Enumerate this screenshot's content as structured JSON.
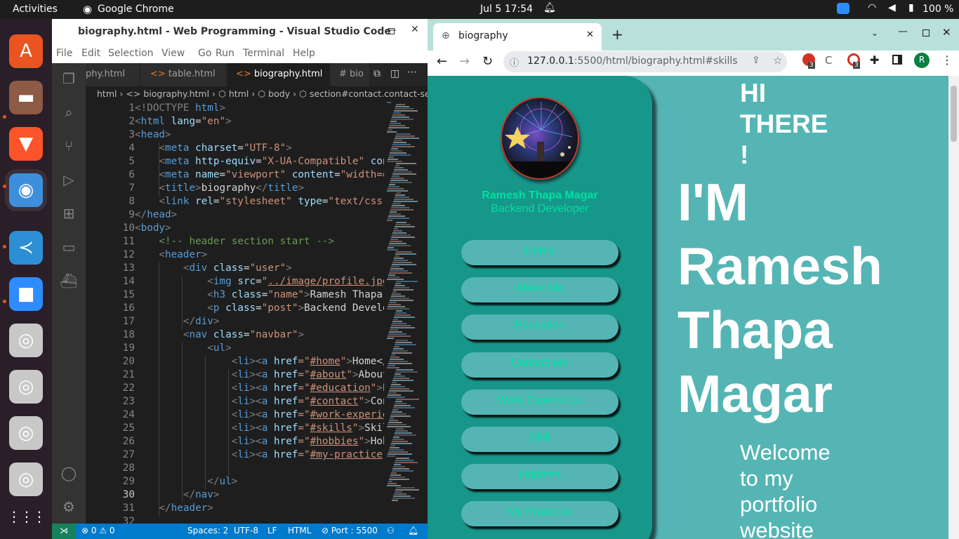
{
  "topbar": {
    "activities": "Activities",
    "app": "Google Chrome",
    "clock": "Jul 5  17:54",
    "battery": "100 %"
  },
  "dock": {
    "items": [
      {
        "name": "software-icon",
        "glyph": "A",
        "color": "#e95420"
      },
      {
        "name": "files-icon",
        "glyph": "▬",
        "color": "#8d5a46"
      },
      {
        "name": "brave-icon",
        "glyph": "▼",
        "color": "#fb542b"
      },
      {
        "name": "chrome-icon",
        "glyph": "◉",
        "color": "#3d8fdc"
      },
      {
        "name": "vscode-icon",
        "glyph": "≺",
        "color": "#2c8fd6"
      },
      {
        "name": "zoom-icon",
        "glyph": "■",
        "color": "#2d8cff"
      },
      {
        "name": "disc-icon-1",
        "glyph": "◎",
        "color": "#c8c8c8"
      },
      {
        "name": "disc-icon-2",
        "glyph": "◎",
        "color": "#c8c8c8"
      },
      {
        "name": "disc-icon-3",
        "glyph": "◎",
        "color": "#c8c8c8"
      },
      {
        "name": "disc-icon-4",
        "glyph": "◎",
        "color": "#c8c8c8"
      }
    ],
    "apps_grid": "⋮⋮⋮"
  },
  "vscode": {
    "title": "biography.html - Web Programming - Visual Studio Code",
    "menu": [
      "File",
      "Edit",
      "Selection",
      "View",
      "Go",
      "Run",
      "Terminal",
      "Help"
    ],
    "tabs": [
      "phy.html",
      "table.html",
      "biography.html",
      "# bio"
    ],
    "breadcrumb": "html  ›  <> biography.html  ›  ⬡ html  ›  ⬡ body  ›  ⬡ section#contact.contact-se",
    "lines": [
      [
        {
          "t": "<!DOCTYPE ",
          "c": "#808080"
        },
        {
          "t": "html",
          "c": "#569cd6"
        },
        {
          "t": ">",
          "c": "#808080"
        }
      ],
      [
        {
          "t": "<",
          "c": "#808080"
        },
        {
          "t": "html ",
          "c": "#569cd6"
        },
        {
          "t": "lang",
          "c": "#9cdcfe"
        },
        {
          "t": "=",
          "c": "#d4d4d4"
        },
        {
          "t": "\"en\"",
          "c": "#ce9178"
        },
        {
          "t": ">",
          "c": "#808080"
        }
      ],
      [
        {
          "t": "<",
          "c": "#808080"
        },
        {
          "t": "head",
          "c": "#569cd6"
        },
        {
          "t": ">",
          "c": "#808080"
        }
      ],
      [
        {
          "t": "    <",
          "c": "#808080"
        },
        {
          "t": "meta ",
          "c": "#569cd6"
        },
        {
          "t": "charset",
          "c": "#9cdcfe"
        },
        {
          "t": "=",
          "c": "#d4d4d4"
        },
        {
          "t": "\"UTF-8\"",
          "c": "#ce9178"
        },
        {
          "t": ">",
          "c": "#808080"
        }
      ],
      [
        {
          "t": "    <",
          "c": "#808080"
        },
        {
          "t": "meta ",
          "c": "#569cd6"
        },
        {
          "t": "http-equiv",
          "c": "#9cdcfe"
        },
        {
          "t": "=",
          "c": "#d4d4d4"
        },
        {
          "t": "\"X-UA-Compatible\" ",
          "c": "#ce9178"
        },
        {
          "t": "con",
          "c": "#9cdcfe"
        }
      ],
      [
        {
          "t": "    <",
          "c": "#808080"
        },
        {
          "t": "meta ",
          "c": "#569cd6"
        },
        {
          "t": "name",
          "c": "#9cdcfe"
        },
        {
          "t": "=",
          "c": "#d4d4d4"
        },
        {
          "t": "\"viewport\" ",
          "c": "#ce9178"
        },
        {
          "t": "content",
          "c": "#9cdcfe"
        },
        {
          "t": "=",
          "c": "#d4d4d4"
        },
        {
          "t": "\"width=d",
          "c": "#ce9178"
        }
      ],
      [
        {
          "t": "    <",
          "c": "#808080"
        },
        {
          "t": "title",
          "c": "#569cd6"
        },
        {
          "t": ">",
          "c": "#808080"
        },
        {
          "t": "biography",
          "c": "#d4d4d4"
        },
        {
          "t": "</",
          "c": "#808080"
        },
        {
          "t": "title",
          "c": "#569cd6"
        },
        {
          "t": ">",
          "c": "#808080"
        }
      ],
      [
        {
          "t": "    <",
          "c": "#808080"
        },
        {
          "t": "link ",
          "c": "#569cd6"
        },
        {
          "t": "rel",
          "c": "#9cdcfe"
        },
        {
          "t": "=",
          "c": "#d4d4d4"
        },
        {
          "t": "\"stylesheet\" ",
          "c": "#ce9178"
        },
        {
          "t": "type",
          "c": "#9cdcfe"
        },
        {
          "t": "=",
          "c": "#d4d4d4"
        },
        {
          "t": "\"text/css\"",
          "c": "#ce9178"
        }
      ],
      [
        {
          "t": "</",
          "c": "#808080"
        },
        {
          "t": "head",
          "c": "#569cd6"
        },
        {
          "t": ">",
          "c": "#808080"
        }
      ],
      [
        {
          "t": "<",
          "c": "#808080"
        },
        {
          "t": "body",
          "c": "#569cd6"
        },
        {
          "t": ">",
          "c": "#808080"
        }
      ],
      [
        {
          "t": "    <!-- header section start -->",
          "c": "#6a9955"
        }
      ],
      [
        {
          "t": "    <",
          "c": "#808080"
        },
        {
          "t": "header",
          "c": "#569cd6"
        },
        {
          "t": ">",
          "c": "#808080"
        }
      ],
      [
        {
          "t": "        <",
          "c": "#808080"
        },
        {
          "t": "div ",
          "c": "#569cd6"
        },
        {
          "t": "class",
          "c": "#9cdcfe"
        },
        {
          "t": "=",
          "c": "#d4d4d4"
        },
        {
          "t": "\"user\"",
          "c": "#ce9178"
        },
        {
          "t": ">",
          "c": "#808080"
        }
      ],
      [
        {
          "t": "            <",
          "c": "#808080"
        },
        {
          "t": "img ",
          "c": "#569cd6"
        },
        {
          "t": "src",
          "c": "#9cdcfe"
        },
        {
          "t": "=",
          "c": "#d4d4d4"
        },
        {
          "t": "\"",
          "c": "#ce9178"
        },
        {
          "t": "../image/profile.jpg",
          "c": "#ce9178",
          "u": true
        }
      ],
      [
        {
          "t": "            <",
          "c": "#808080"
        },
        {
          "t": "h3 ",
          "c": "#569cd6"
        },
        {
          "t": "class",
          "c": "#9cdcfe"
        },
        {
          "t": "=",
          "c": "#d4d4d4"
        },
        {
          "t": "\"name\"",
          "c": "#ce9178"
        },
        {
          "t": ">",
          "c": "#808080"
        },
        {
          "t": "Ramesh Thapa ",
          "c": "#d4d4d4"
        }
      ],
      [
        {
          "t": "            <",
          "c": "#808080"
        },
        {
          "t": "p ",
          "c": "#569cd6"
        },
        {
          "t": "class",
          "c": "#9cdcfe"
        },
        {
          "t": "=",
          "c": "#d4d4d4"
        },
        {
          "t": "\"post\"",
          "c": "#ce9178"
        },
        {
          "t": ">",
          "c": "#808080"
        },
        {
          "t": "Backend Develo",
          "c": "#d4d4d4"
        }
      ],
      [
        {
          "t": "        </",
          "c": "#808080"
        },
        {
          "t": "div",
          "c": "#569cd6"
        },
        {
          "t": ">",
          "c": "#808080"
        }
      ],
      [
        {
          "t": "        <",
          "c": "#808080"
        },
        {
          "t": "nav ",
          "c": "#569cd6"
        },
        {
          "t": "class",
          "c": "#9cdcfe"
        },
        {
          "t": "=",
          "c": "#d4d4d4"
        },
        {
          "t": "\"navbar\"",
          "c": "#ce9178"
        },
        {
          "t": ">",
          "c": "#808080"
        }
      ],
      [
        {
          "t": "            <",
          "c": "#808080"
        },
        {
          "t": "ul",
          "c": "#569cd6"
        },
        {
          "t": ">",
          "c": "#808080"
        }
      ],
      [
        {
          "t": "                <",
          "c": "#808080"
        },
        {
          "t": "li",
          "c": "#569cd6"
        },
        {
          "t": "><",
          "c": "#808080"
        },
        {
          "t": "a ",
          "c": "#569cd6"
        },
        {
          "t": "href",
          "c": "#9cdcfe"
        },
        {
          "t": "=\"",
          "c": "#ce9178"
        },
        {
          "t": "#home",
          "c": "#ce9178",
          "u": true
        },
        {
          "t": "\"",
          "c": "#ce9178"
        },
        {
          "t": ">",
          "c": "#808080"
        },
        {
          "t": "Home</",
          "c": "#d4d4d4"
        }
      ],
      [
        {
          "t": "                <",
          "c": "#808080"
        },
        {
          "t": "li",
          "c": "#569cd6"
        },
        {
          "t": "><",
          "c": "#808080"
        },
        {
          "t": "a ",
          "c": "#569cd6"
        },
        {
          "t": "href",
          "c": "#9cdcfe"
        },
        {
          "t": "=\"",
          "c": "#ce9178"
        },
        {
          "t": "#about",
          "c": "#ce9178",
          "u": true
        },
        {
          "t": "\"",
          "c": "#ce9178"
        },
        {
          "t": ">",
          "c": "#808080"
        },
        {
          "t": "About",
          "c": "#d4d4d4"
        }
      ],
      [
        {
          "t": "                <",
          "c": "#808080"
        },
        {
          "t": "li",
          "c": "#569cd6"
        },
        {
          "t": "><",
          "c": "#808080"
        },
        {
          "t": "a ",
          "c": "#569cd6"
        },
        {
          "t": "href",
          "c": "#9cdcfe"
        },
        {
          "t": "=\"",
          "c": "#ce9178"
        },
        {
          "t": "#education",
          "c": "#ce9178",
          "u": true
        },
        {
          "t": "\"",
          "c": "#ce9178"
        },
        {
          "t": ">",
          "c": "#808080"
        },
        {
          "t": "E",
          "c": "#d4d4d4"
        }
      ],
      [
        {
          "t": "                <",
          "c": "#808080"
        },
        {
          "t": "li",
          "c": "#569cd6"
        },
        {
          "t": "><",
          "c": "#808080"
        },
        {
          "t": "a ",
          "c": "#569cd6"
        },
        {
          "t": "href",
          "c": "#9cdcfe"
        },
        {
          "t": "=\"",
          "c": "#ce9178"
        },
        {
          "t": "#contact",
          "c": "#ce9178",
          "u": true
        },
        {
          "t": "\"",
          "c": "#ce9178"
        },
        {
          "t": ">",
          "c": "#808080"
        },
        {
          "t": "Con",
          "c": "#d4d4d4"
        }
      ],
      [
        {
          "t": "                <",
          "c": "#808080"
        },
        {
          "t": "li",
          "c": "#569cd6"
        },
        {
          "t": "><",
          "c": "#808080"
        },
        {
          "t": "a ",
          "c": "#569cd6"
        },
        {
          "t": "href",
          "c": "#9cdcfe"
        },
        {
          "t": "=\"",
          "c": "#ce9178"
        },
        {
          "t": "#work-experie",
          "c": "#ce9178",
          "u": true
        }
      ],
      [
        {
          "t": "                <",
          "c": "#808080"
        },
        {
          "t": "li",
          "c": "#569cd6"
        },
        {
          "t": "><",
          "c": "#808080"
        },
        {
          "t": "a ",
          "c": "#569cd6"
        },
        {
          "t": "href",
          "c": "#9cdcfe"
        },
        {
          "t": "=\"",
          "c": "#ce9178"
        },
        {
          "t": "#skills",
          "c": "#ce9178",
          "u": true
        },
        {
          "t": "\"",
          "c": "#ce9178"
        },
        {
          "t": ">",
          "c": "#808080"
        },
        {
          "t": "Skil",
          "c": "#d4d4d4"
        }
      ],
      [
        {
          "t": "                <",
          "c": "#808080"
        },
        {
          "t": "li",
          "c": "#569cd6"
        },
        {
          "t": "><",
          "c": "#808080"
        },
        {
          "t": "a ",
          "c": "#569cd6"
        },
        {
          "t": "href",
          "c": "#9cdcfe"
        },
        {
          "t": "=\"",
          "c": "#ce9178"
        },
        {
          "t": "#hobbies",
          "c": "#ce9178",
          "u": true
        },
        {
          "t": "\"",
          "c": "#ce9178"
        },
        {
          "t": ">",
          "c": "#808080"
        },
        {
          "t": "Hob",
          "c": "#d4d4d4"
        }
      ],
      [
        {
          "t": "                <",
          "c": "#808080"
        },
        {
          "t": "li",
          "c": "#569cd6"
        },
        {
          "t": "><",
          "c": "#808080"
        },
        {
          "t": "a ",
          "c": "#569cd6"
        },
        {
          "t": "href",
          "c": "#9cdcfe"
        },
        {
          "t": "=\"",
          "c": "#ce9178"
        },
        {
          "t": "#my-practice",
          "c": "#ce9178",
          "u": true
        },
        {
          "t": "\"",
          "c": "#ce9178"
        }
      ],
      [
        {
          "t": "",
          "c": "#d4d4d4"
        }
      ],
      [
        {
          "t": "            </",
          "c": "#808080"
        },
        {
          "t": "ul",
          "c": "#569cd6"
        },
        {
          "t": ">",
          "c": "#808080"
        }
      ],
      [
        {
          "t": "        </",
          "c": "#808080"
        },
        {
          "t": "nav",
          "c": "#569cd6"
        },
        {
          "t": ">",
          "c": "#808080"
        }
      ],
      [
        {
          "t": "    </",
          "c": "#808080"
        },
        {
          "t": "header",
          "c": "#569cd6"
        },
        {
          "t": ">",
          "c": "#808080"
        }
      ],
      [
        {
          "t": "",
          "c": "#d4d4d4"
        }
      ]
    ],
    "status": {
      "errors": "⊗ 0 ⚠ 0",
      "spaces": "Spaces: 2",
      "encoding": "UTF-8",
      "eol": "LF",
      "lang": "HTML",
      "port": "⊘ Port : 5500"
    }
  },
  "chrome": {
    "tab_title": "biography",
    "url_host": "127.0.0.1",
    "url_rest": ":5500/html/biography.html#skills",
    "profile": "R",
    "badge": "3"
  },
  "site": {
    "name": "Ramesh Thapa Magar",
    "post": "Backend Developer",
    "nav": [
      "Home",
      "About Me",
      "Education",
      "Contact Me",
      "Work Experience",
      "Skill",
      "Hobbies",
      "My Practices"
    ],
    "hi": [
      "HI",
      "THERE",
      "!"
    ],
    "im": [
      "I'M",
      "Ramesh",
      "Thapa",
      "Magar"
    ],
    "welcome": [
      "Welcome",
      "to my",
      "portfolio",
      "website"
    ],
    "colors": {
      "sidebar": "#17968a",
      "page": "#55b5b4",
      "accent": "#00e0a0"
    }
  }
}
